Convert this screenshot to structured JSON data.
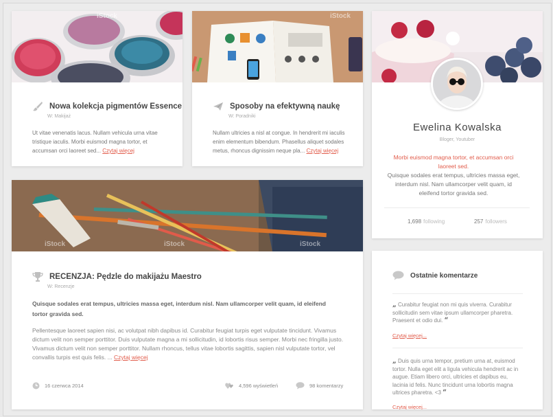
{
  "colors": {
    "accent": "#e15b4a",
    "card": "#ffffff",
    "background": "#ececec"
  },
  "posts": {
    "p1": {
      "title": "Nowa kolekcja pigmentów Essence",
      "meta": "W: Makijaż",
      "text": "Ut vitae venenatis lacus. Nullam vehicula urna vitae tristique iaculis. Morbi euismod magna tortor, et accumsan orci laoreet sed... ",
      "read_more": "Czytaj więcej",
      "icon": "brush-icon"
    },
    "p2": {
      "title": "Sposoby na efektywną naukę",
      "meta": "W: Poradniki",
      "text": "Nullam ultricies a nisl at congue. In hendrerit mi iaculis enim elementum bibendum. Phasellus aliquet sodales metus, rhoncus dignissim neque pla... ",
      "read_more": "Czytaj więcej",
      "icon": "paper-plane-icon"
    },
    "big": {
      "title": "RECENZJA: Pędzle do makijażu Maestro",
      "meta": "W: Recenzje",
      "lead": "Quisque sodales erat tempus, ultricies massa eget, interdum nisl. Nam ullamcorper velit quam, id eleifend tortor gravida sed.",
      "body": "Pellentesque laoreet sapien nisi, ac volutpat nibh dapibus id. Curabitur feugiat turpis eget vulputate tincidunt. Vivamus dictum velit non semper porttitor. Duis vulputate magna a mi sollicitudin, id lobortis risus semper. Morbi nec fringilla justo.  Vivamus dictum velit non semper porttitor. Nullam rhoncus, tellus vitae lobortis sagittis, sapien nisl vulputate tortor, vel convallis turpis est quis felis. ... ",
      "read_more": "Czytaj więcej",
      "date": "16 czerwca 2014",
      "views": "4,596 wyświetleń",
      "comments": "98 komentarzy",
      "icon": "trophy-icon",
      "watermark": "iStock"
    }
  },
  "profile": {
    "name": "Ewelina Kowalska",
    "role": "Bloger, Youtuber",
    "quote": "Morbi euismod magna tortor, et accumsan orci laoreet sed.",
    "bio": "Quisque sodales erat tempus, ultricies massa eget, interdum nisl. Nam ullamcorper velit quam, id eleifend tortor gravida sed.",
    "following_count": "1,698",
    "following_label": "following",
    "followers_count": "257",
    "followers_label": "followers"
  },
  "comments_widget": {
    "title": "Ostatnie komentarze",
    "items": [
      {
        "open": "„",
        "text": "Curabitur feugiat non mi quis viverra. Curabitur sollicitudin sem vitae ipsum ullamcorper pharetra. Praesent et odio dui.",
        "close": "“",
        "read_more": "Czytaj więcej..."
      },
      {
        "open": "„",
        "text": "Duis quis urna tempor, pretium urna at, euismod tortor. Nulla eget elit a ligula vehicula hendrerit ac in augue. Etiam libero orci, ultricies et dapibus eu, lacinia id felis. Nunc tincidunt urna lobortis magna ultrices pharetra. <3",
        "close": "“",
        "read_more": "Czytaj więcej..."
      }
    ]
  }
}
